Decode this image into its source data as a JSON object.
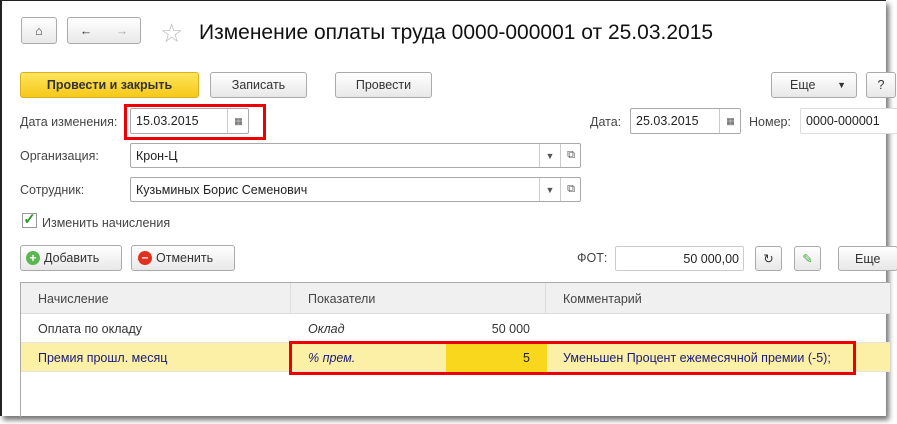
{
  "title": "Изменение оплаты труда 0000-000001 от 25.03.2015",
  "toolbar": {
    "post_close": "Провести и закрыть",
    "save": "Записать",
    "post": "Провести",
    "more": "Еще",
    "help": "?"
  },
  "form": {
    "change_date_label": "Дата изменения:",
    "change_date": "15.03.2015",
    "date_label": "Дата:",
    "date": "25.03.2015",
    "number_label": "Номер:",
    "number": "0000-000001",
    "org_label": "Организация:",
    "org": "Крон-Ц",
    "employee_label": "Сотрудник:",
    "employee": "Кузьминых Борис Семенович",
    "change_accruals_label": "Изменить начисления",
    "change_accruals": true
  },
  "table_toolbar": {
    "add": "Добавить",
    "cancel": "Отменить",
    "fot_label": "ФОТ:",
    "fot": "50 000,00",
    "more": "Еще"
  },
  "table": {
    "headers": [
      "Начисление",
      "Показатели",
      "Комментарий"
    ],
    "rows": [
      {
        "accrual": "Оплата по окладу",
        "indicator": "Оклад",
        "value": "50 000",
        "comment": ""
      },
      {
        "accrual": "Премия прошл. месяц",
        "indicator": "% прем.",
        "value": "5",
        "comment": "Уменьшен Процент ежемесячной премии (-5);"
      }
    ]
  },
  "colors": {
    "accent_yellow": "#f5c919",
    "selected_row": "#fbf0a6",
    "highlight_red": "#e00000"
  }
}
